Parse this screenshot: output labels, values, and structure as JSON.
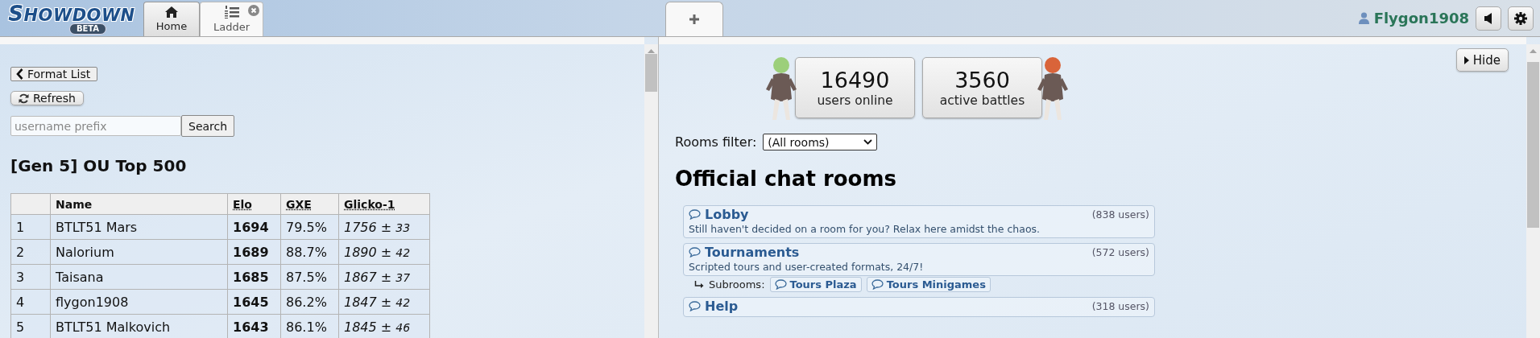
{
  "header": {
    "logo": {
      "title": "SHOWDOWN",
      "badge": "BETA"
    },
    "tabs": [
      {
        "kind": "home",
        "label": "Home",
        "selected": false,
        "closable": false
      },
      {
        "kind": "ladder",
        "label": "Ladder",
        "selected": true,
        "closable": true
      }
    ],
    "user": {
      "name": "Flygon1908"
    }
  },
  "ladder_panel": {
    "back_button": "Format List",
    "refresh_button": "Refresh",
    "search": {
      "placeholder": "username prefix",
      "button": "Search"
    },
    "title": "[Gen 5] OU Top 500",
    "table": {
      "columns": [
        "Name",
        "Elo",
        "GXE",
        "Glicko-1"
      ],
      "rows": [
        {
          "rank": "1",
          "name": "BTLT51 Mars",
          "elo": "1694",
          "gxe": "79.5%",
          "glicko": "1756",
          "plus_minus": "±",
          "deviation": "33"
        },
        {
          "rank": "2",
          "name": "Nalorium",
          "elo": "1689",
          "gxe": "88.7%",
          "glicko": "1890",
          "plus_minus": "±",
          "deviation": "42"
        },
        {
          "rank": "3",
          "name": "Taisana",
          "elo": "1685",
          "gxe": "87.5%",
          "glicko": "1867",
          "plus_minus": "±",
          "deviation": "37"
        },
        {
          "rank": "4",
          "name": "flygon1908",
          "elo": "1645",
          "gxe": "86.2%",
          "glicko": "1847",
          "plus_minus": "±",
          "deviation": "42"
        },
        {
          "rank": "5",
          "name": "BTLT51 Malkovich",
          "elo": "1643",
          "gxe": "86.1%",
          "glicko": "1845",
          "plus_minus": "±",
          "deviation": "46"
        }
      ]
    }
  },
  "main_panel": {
    "hide_button": "Hide",
    "stats": [
      {
        "value": "16490",
        "label": "users online"
      },
      {
        "value": "3560",
        "label": "active battles"
      }
    ],
    "rooms_filter": {
      "label": "Rooms filter:",
      "value": "(All rooms)"
    },
    "heading": "Official chat rooms",
    "rooms": [
      {
        "name": "Lobby",
        "users": "(838 users)",
        "description": "Still haven't decided on a room for you? Relax here amidst the chaos."
      },
      {
        "name": "Tournaments",
        "users": "(572 users)",
        "description": "Scripted tours and user-created formats, 24/7!",
        "subrooms": {
          "label": "Subrooms:",
          "items": [
            "Tours Plaza",
            "Tours Minigames"
          ]
        }
      },
      {
        "name": "Help",
        "users": "(318 users)"
      }
    ]
  }
}
